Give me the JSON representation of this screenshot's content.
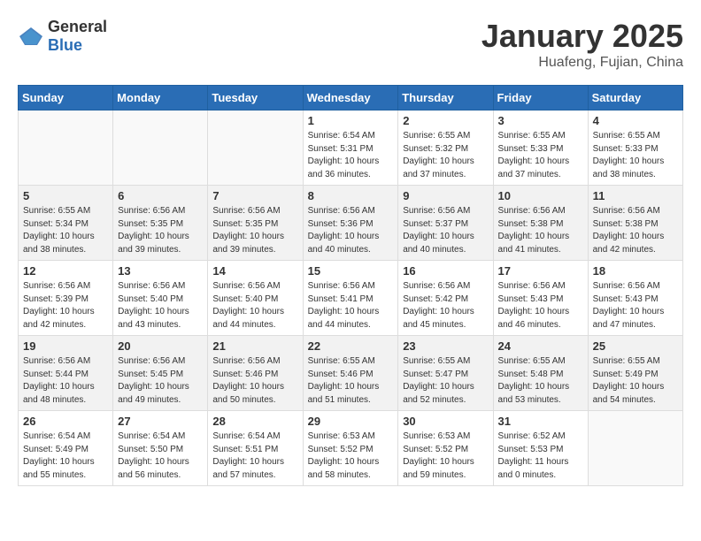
{
  "logo": {
    "general": "General",
    "blue": "Blue"
  },
  "title": "January 2025",
  "location": "Huafeng, Fujian, China",
  "weekdays": [
    "Sunday",
    "Monday",
    "Tuesday",
    "Wednesday",
    "Thursday",
    "Friday",
    "Saturday"
  ],
  "weeks": [
    {
      "shaded": false,
      "days": [
        {
          "number": "",
          "info": ""
        },
        {
          "number": "",
          "info": ""
        },
        {
          "number": "",
          "info": ""
        },
        {
          "number": "1",
          "info": "Sunrise: 6:54 AM\nSunset: 5:31 PM\nDaylight: 10 hours\nand 36 minutes."
        },
        {
          "number": "2",
          "info": "Sunrise: 6:55 AM\nSunset: 5:32 PM\nDaylight: 10 hours\nand 37 minutes."
        },
        {
          "number": "3",
          "info": "Sunrise: 6:55 AM\nSunset: 5:33 PM\nDaylight: 10 hours\nand 37 minutes."
        },
        {
          "number": "4",
          "info": "Sunrise: 6:55 AM\nSunset: 5:33 PM\nDaylight: 10 hours\nand 38 minutes."
        }
      ]
    },
    {
      "shaded": true,
      "days": [
        {
          "number": "5",
          "info": "Sunrise: 6:55 AM\nSunset: 5:34 PM\nDaylight: 10 hours\nand 38 minutes."
        },
        {
          "number": "6",
          "info": "Sunrise: 6:56 AM\nSunset: 5:35 PM\nDaylight: 10 hours\nand 39 minutes."
        },
        {
          "number": "7",
          "info": "Sunrise: 6:56 AM\nSunset: 5:35 PM\nDaylight: 10 hours\nand 39 minutes."
        },
        {
          "number": "8",
          "info": "Sunrise: 6:56 AM\nSunset: 5:36 PM\nDaylight: 10 hours\nand 40 minutes."
        },
        {
          "number": "9",
          "info": "Sunrise: 6:56 AM\nSunset: 5:37 PM\nDaylight: 10 hours\nand 40 minutes."
        },
        {
          "number": "10",
          "info": "Sunrise: 6:56 AM\nSunset: 5:38 PM\nDaylight: 10 hours\nand 41 minutes."
        },
        {
          "number": "11",
          "info": "Sunrise: 6:56 AM\nSunset: 5:38 PM\nDaylight: 10 hours\nand 42 minutes."
        }
      ]
    },
    {
      "shaded": false,
      "days": [
        {
          "number": "12",
          "info": "Sunrise: 6:56 AM\nSunset: 5:39 PM\nDaylight: 10 hours\nand 42 minutes."
        },
        {
          "number": "13",
          "info": "Sunrise: 6:56 AM\nSunset: 5:40 PM\nDaylight: 10 hours\nand 43 minutes."
        },
        {
          "number": "14",
          "info": "Sunrise: 6:56 AM\nSunset: 5:40 PM\nDaylight: 10 hours\nand 44 minutes."
        },
        {
          "number": "15",
          "info": "Sunrise: 6:56 AM\nSunset: 5:41 PM\nDaylight: 10 hours\nand 44 minutes."
        },
        {
          "number": "16",
          "info": "Sunrise: 6:56 AM\nSunset: 5:42 PM\nDaylight: 10 hours\nand 45 minutes."
        },
        {
          "number": "17",
          "info": "Sunrise: 6:56 AM\nSunset: 5:43 PM\nDaylight: 10 hours\nand 46 minutes."
        },
        {
          "number": "18",
          "info": "Sunrise: 6:56 AM\nSunset: 5:43 PM\nDaylight: 10 hours\nand 47 minutes."
        }
      ]
    },
    {
      "shaded": true,
      "days": [
        {
          "number": "19",
          "info": "Sunrise: 6:56 AM\nSunset: 5:44 PM\nDaylight: 10 hours\nand 48 minutes."
        },
        {
          "number": "20",
          "info": "Sunrise: 6:56 AM\nSunset: 5:45 PM\nDaylight: 10 hours\nand 49 minutes."
        },
        {
          "number": "21",
          "info": "Sunrise: 6:56 AM\nSunset: 5:46 PM\nDaylight: 10 hours\nand 50 minutes."
        },
        {
          "number": "22",
          "info": "Sunrise: 6:55 AM\nSunset: 5:46 PM\nDaylight: 10 hours\nand 51 minutes."
        },
        {
          "number": "23",
          "info": "Sunrise: 6:55 AM\nSunset: 5:47 PM\nDaylight: 10 hours\nand 52 minutes."
        },
        {
          "number": "24",
          "info": "Sunrise: 6:55 AM\nSunset: 5:48 PM\nDaylight: 10 hours\nand 53 minutes."
        },
        {
          "number": "25",
          "info": "Sunrise: 6:55 AM\nSunset: 5:49 PM\nDaylight: 10 hours\nand 54 minutes."
        }
      ]
    },
    {
      "shaded": false,
      "days": [
        {
          "number": "26",
          "info": "Sunrise: 6:54 AM\nSunset: 5:49 PM\nDaylight: 10 hours\nand 55 minutes."
        },
        {
          "number": "27",
          "info": "Sunrise: 6:54 AM\nSunset: 5:50 PM\nDaylight: 10 hours\nand 56 minutes."
        },
        {
          "number": "28",
          "info": "Sunrise: 6:54 AM\nSunset: 5:51 PM\nDaylight: 10 hours\nand 57 minutes."
        },
        {
          "number": "29",
          "info": "Sunrise: 6:53 AM\nSunset: 5:52 PM\nDaylight: 10 hours\nand 58 minutes."
        },
        {
          "number": "30",
          "info": "Sunrise: 6:53 AM\nSunset: 5:52 PM\nDaylight: 10 hours\nand 59 minutes."
        },
        {
          "number": "31",
          "info": "Sunrise: 6:52 AM\nSunset: 5:53 PM\nDaylight: 11 hours\nand 0 minutes."
        },
        {
          "number": "",
          "info": ""
        }
      ]
    }
  ]
}
